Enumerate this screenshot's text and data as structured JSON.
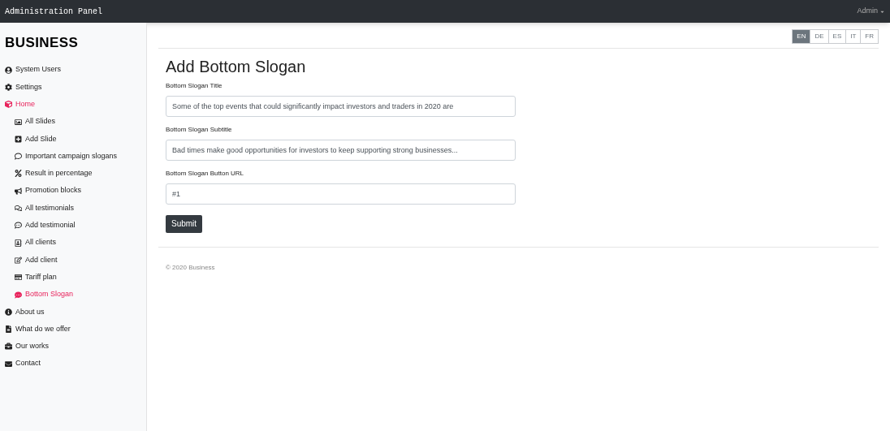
{
  "topbar": {
    "title": "Administration Panel",
    "user_menu": "Admin"
  },
  "sidebar": {
    "brand": "BUSINESS",
    "items": [
      {
        "label": "System Users",
        "selected": false
      },
      {
        "label": "Settings",
        "selected": false
      },
      {
        "label": "Home",
        "selected": true,
        "children": [
          {
            "label": "All Slides",
            "selected": false
          },
          {
            "label": "Add Slide",
            "selected": false
          },
          {
            "label": "Important campaign slogans",
            "selected": false
          },
          {
            "label": "Result in percentage",
            "selected": false
          },
          {
            "label": "Promotion blocks",
            "selected": false
          },
          {
            "label": "All testimonials",
            "selected": false
          },
          {
            "label": "Add testimonial",
            "selected": false
          },
          {
            "label": "All clients",
            "selected": false
          },
          {
            "label": "Add client",
            "selected": false
          },
          {
            "label": "Tariff plan",
            "selected": false
          },
          {
            "label": "Bottom Slogan",
            "selected": true
          }
        ]
      },
      {
        "label": "About us",
        "selected": false
      },
      {
        "label": "What do we offer",
        "selected": false
      },
      {
        "label": "Our works",
        "selected": false
      },
      {
        "label": "Contact",
        "selected": false
      }
    ]
  },
  "languages": [
    {
      "label": "EN",
      "selected": true
    },
    {
      "label": "DE",
      "selected": false
    },
    {
      "label": "ES",
      "selected": false
    },
    {
      "label": "IT",
      "selected": false
    },
    {
      "label": "FR",
      "selected": false
    }
  ],
  "form": {
    "heading": "Add Bottom Slogan",
    "fields": [
      {
        "label": "Bottom Slogan Title",
        "value": "Some of the top events that could significantly impact investors and traders in 2020 are"
      },
      {
        "label": "Bottom Slogan Subtitle",
        "value": "Bad times make good opportunities for investors to keep supporting strong businesses..."
      },
      {
        "label": "Bottom Slogan Button URL",
        "value": "#1"
      }
    ],
    "submit": "Submit"
  },
  "footer": "© 2020 Business"
}
